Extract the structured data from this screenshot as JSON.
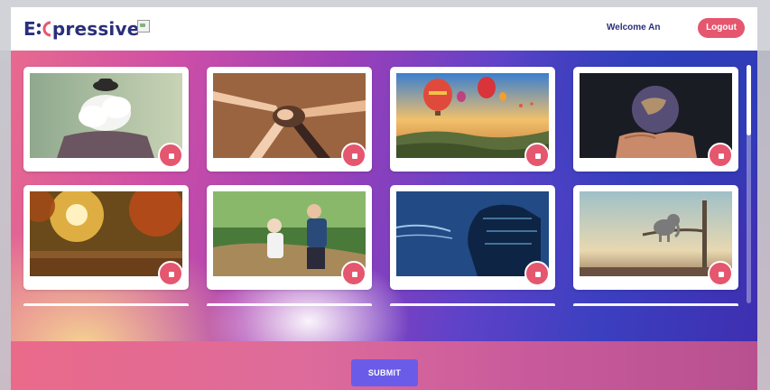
{
  "header": {
    "logo_prefix": "E",
    "logo_suffix": "pressive",
    "welcome_text": "Welcome An",
    "logout_label": "Logout"
  },
  "colors": {
    "accent_pink": "#e5566f",
    "brand_navy": "#2a2f7a",
    "submit_purple": "#6a5ce8"
  },
  "gallery": {
    "items": [
      {
        "subject": "man with cloud head",
        "button_icon": "stop-icon"
      },
      {
        "subject": "joined hands",
        "button_icon": "stop-icon"
      },
      {
        "subject": "hot air balloons",
        "button_icon": "stop-icon"
      },
      {
        "subject": "hands holding earth",
        "button_icon": "stop-icon"
      },
      {
        "subject": "autumn forest",
        "button_icon": "stop-icon"
      },
      {
        "subject": "senior couple jogging",
        "button_icon": "stop-icon"
      },
      {
        "subject": "digital face",
        "button_icon": "stop-icon"
      },
      {
        "subject": "elephant on branch",
        "button_icon": "stop-icon"
      }
    ]
  },
  "footer": {
    "submit_label": "SUBMIT"
  }
}
